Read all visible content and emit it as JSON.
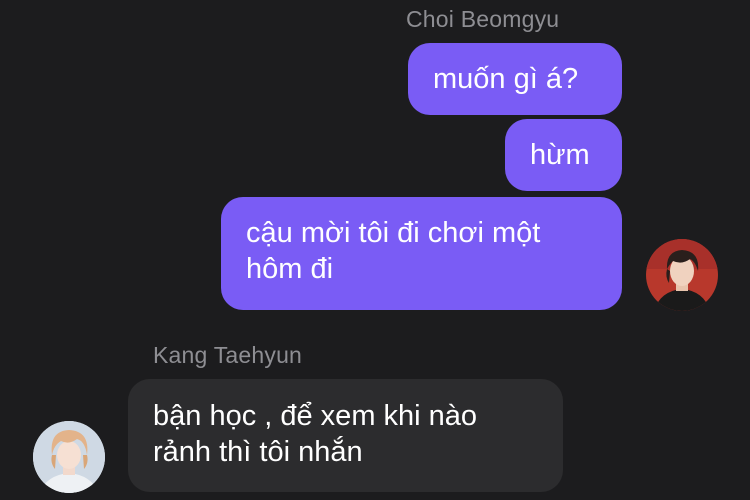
{
  "conversation": {
    "outgoing": {
      "sender": "Choi Beomgyu",
      "messages": [
        "muốn gì á?",
        "hừm",
        "cậu mời tôi đi chơi một hôm đi"
      ],
      "avatar_icon": "avatar-photo-dark-hair"
    },
    "incoming": {
      "sender": "Kang Taehyun",
      "messages": [
        "bận học , để xem khi nào rảnh thì tôi nhắn"
      ],
      "avatar_icon": "avatar-photo-blonde-hair"
    }
  },
  "colors": {
    "background": "#1c1c1e",
    "outgoing_bubble": "#7a5cf5",
    "incoming_bubble": "#2c2c2e",
    "name_text": "#8e8e93",
    "message_text": "#ffffff"
  }
}
